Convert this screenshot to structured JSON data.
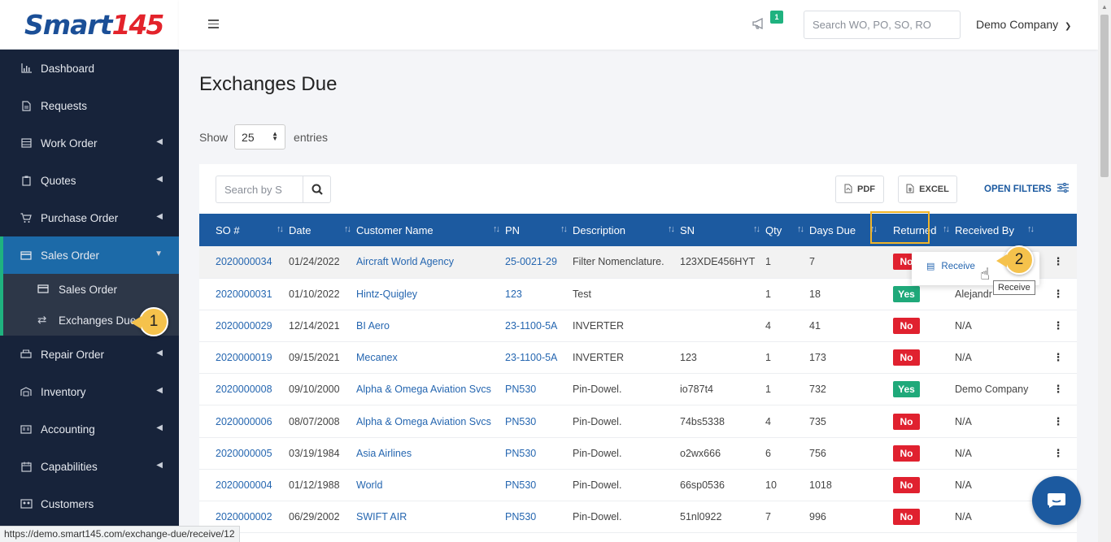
{
  "app": {
    "logo_text": "Smart",
    "logo_num": "145"
  },
  "sidebar": {
    "items": [
      {
        "label": "Dashboard"
      },
      {
        "label": "Requests"
      },
      {
        "label": "Work Order"
      },
      {
        "label": "Quotes"
      },
      {
        "label": "Purchase Order"
      },
      {
        "label": "Sales Order"
      },
      {
        "label": "Repair Order"
      },
      {
        "label": "Inventory"
      },
      {
        "label": "Accounting"
      },
      {
        "label": "Capabilities"
      },
      {
        "label": "Customers"
      }
    ],
    "sub_items": [
      {
        "label": "Sales Order"
      },
      {
        "label": "Exchanges Due"
      }
    ]
  },
  "header": {
    "notif_count": "1",
    "search_placeholder": "Search WO, PO, SO, RO",
    "company": "Demo Company"
  },
  "page": {
    "title": "Exchanges Due",
    "show_label": "Show",
    "entries_value": "25",
    "entries_label": "entries"
  },
  "toolbar": {
    "search_placeholder": "Search by S",
    "pdf_label": "PDF",
    "excel_label": "EXCEL",
    "filters_label": "OPEN FILTERS"
  },
  "table": {
    "headers": [
      "SO #",
      "Date",
      "Customer Name",
      "PN",
      "Description",
      "SN",
      "Qty",
      "Days Due",
      "Returned",
      "Received By"
    ],
    "rows": [
      {
        "so": "2020000034",
        "date": "01/24/2022",
        "customer": "Aircraft World Agency",
        "pn": "25-0021-29",
        "desc": "Filter Nomenclature.",
        "sn": "123XDE456HYT",
        "qty": "1",
        "days": "7",
        "returned": "No",
        "received_by": ""
      },
      {
        "so": "2020000031",
        "date": "01/10/2022",
        "customer": "Hintz-Quigley",
        "pn": "123",
        "desc": "Test",
        "sn": "",
        "qty": "1",
        "days": "18",
        "returned": "Yes",
        "received_by": "Alejandr"
      },
      {
        "so": "2020000029",
        "date": "12/14/2021",
        "customer": "BI Aero",
        "pn": "23-1100-5A",
        "desc": "INVERTER",
        "sn": "",
        "qty": "4",
        "days": "41",
        "returned": "No",
        "received_by": "N/A"
      },
      {
        "so": "2020000019",
        "date": "09/15/2021",
        "customer": "Mecanex",
        "pn": "23-1100-5A",
        "desc": "INVERTER",
        "sn": "123",
        "qty": "1",
        "days": "173",
        "returned": "No",
        "received_by": "N/A"
      },
      {
        "so": "2020000008",
        "date": "09/10/2000",
        "customer": "Alpha & Omega Aviation Svcs",
        "pn": "PN530",
        "desc": "Pin-Dowel.",
        "sn": "io787t4",
        "qty": "1",
        "days": "732",
        "returned": "Yes",
        "received_by": "Demo Company"
      },
      {
        "so": "2020000006",
        "date": "08/07/2008",
        "customer": "Alpha & Omega Aviation Svcs",
        "pn": "PN530",
        "desc": "Pin-Dowel.",
        "sn": "74bs5338",
        "qty": "4",
        "days": "735",
        "returned": "No",
        "received_by": "N/A"
      },
      {
        "so": "2020000005",
        "date": "03/19/1984",
        "customer": "Asia Airlines",
        "pn": "PN530",
        "desc": "Pin-Dowel.",
        "sn": "o2wx666",
        "qty": "6",
        "days": "756",
        "returned": "No",
        "received_by": "N/A"
      },
      {
        "so": "2020000004",
        "date": "01/12/1988",
        "customer": "World",
        "pn": "PN530",
        "desc": "Pin-Dowel.",
        "sn": "66sp0536",
        "qty": "10",
        "days": "1018",
        "returned": "No",
        "received_by": "N/A"
      },
      {
        "so": "2020000002",
        "date": "06/29/2002",
        "customer": "SWIFT AIR",
        "pn": "PN530",
        "desc": "Pin-Dowel.",
        "sn": "51nl0922",
        "qty": "7",
        "days": "996",
        "returned": "No",
        "received_by": "N/A"
      }
    ]
  },
  "popup": {
    "item_label": "Receive",
    "tooltip": "Receive"
  },
  "callouts": {
    "one": "1",
    "two": "2"
  },
  "status_url": "https://demo.smart145.com/exchange-due/receive/12",
  "colors": {
    "sidebar": "#17233a",
    "accent": "#1c5aa0",
    "no": "#e0212f",
    "yes": "#1fa97a",
    "callout": "#f5c24c"
  }
}
